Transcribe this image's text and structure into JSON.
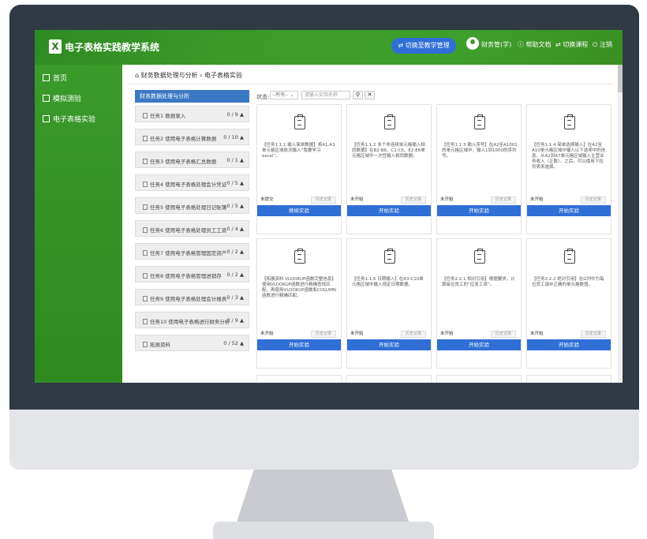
{
  "header": {
    "logo_letter": "X",
    "app_title": "电子表格实践教学系统",
    "switch_label": "切换至教学管理",
    "user_name": "财务管(学)",
    "help_label": "帮助文档",
    "course_switch_label": "切换课程",
    "logout_label": "注销"
  },
  "sidebar": {
    "items": [
      {
        "label": "首页",
        "icon": "home-icon"
      },
      {
        "label": "模拟测验",
        "icon": "quiz-icon"
      },
      {
        "label": "电子表格实验",
        "icon": "spreadsheet-icon"
      }
    ]
  },
  "breadcrumb": {
    "first": "财务数据处理与分析",
    "separator": "›",
    "second": "电子表格实验"
  },
  "tasks": {
    "header": "财务数据处理与分析",
    "items": [
      {
        "label": "任务1 数据录入",
        "count": "0 / 9"
      },
      {
        "label": "任务2 使用电子表格计算数据",
        "count": "0 / 10"
      },
      {
        "label": "任务3 使用电子表格汇总数据",
        "count": "0 / 1"
      },
      {
        "label": "任务4 使用电子表格处理会计凭证",
        "count": "0 / 5"
      },
      {
        "label": "任务5 使用电子表格处理日记账簿",
        "count": "0 / 5"
      },
      {
        "label": "任务6 使用电子表格处理员工工资",
        "count": "0 / 4"
      },
      {
        "label": "任务7 使用电子表格管理固定资产",
        "count": "0 / 2"
      },
      {
        "label": "任务8 使用电子表格管理进销存",
        "count": "0 / 2"
      },
      {
        "label": "任务9 使用电子表格处理会计报表",
        "count": "0 / 3"
      },
      {
        "label": "任务10 使用电子表格进行财务分析",
        "count": "0 / 9"
      },
      {
        "label": "拓展资料",
        "count": "0 / 52"
      }
    ]
  },
  "filter": {
    "label": "状态:",
    "select_value": "--所有--",
    "search_placeholder": "请输入实验名称",
    "search_icon": "search-icon",
    "clear_icon": "close-icon"
  },
  "cards": [
    {
      "desc": "【任务1.1.1 输入简单数据】将A1:A3单元格区域依次输入“我要学习excel”。",
      "status": "未提交",
      "history": "历史记录",
      "button": "继续实验"
    },
    {
      "desc": "【任务1.1.2 多个非连续单元格输入相同数据】在B2:B6、C2:C6、E2:E6单元格区域中一次性输入相同数据。",
      "status": "未开始",
      "history": "历史记录",
      "button": "开始实验"
    },
    {
      "desc": "【任务1.1.3 输入序号】在A2至A1001的单元格区域中，输入1到1000的序列号。",
      "status": "未开始",
      "history": "历史记录",
      "button": "开始实验"
    },
    {
      "desc": "【任务1.1.4 简单选择输入】在A2至A10单元格区域中输入以下选项中的信息，从A2到A7单元格区域输入主营业务收入（正数），之后，可以使用下拉列表来选择。",
      "status": "未开始",
      "history": "历史记录",
      "button": "开始实验"
    },
    {
      "desc": "【拓展资料 VLOOKUP函数完整信息】使用VLOOKUP函数进行精确查找匹配，再使用VLOOKUP函数和COLUMN函数进行精确匹配。",
      "status": "未开始",
      "history": "历史记录",
      "button": "开始实验"
    },
    {
      "desc": "【任务1.1.6 日期输入】在A3:C10单元格区域中输入规定日期数据。",
      "status": "未开始",
      "history": "历史记录",
      "button": "开始实验"
    },
    {
      "desc": "【任务2.2.1 相对引用】根据要求，计算每位员工的“应发工资”。",
      "status": "未开始",
      "history": "历史记录",
      "button": "开始实验"
    },
    {
      "desc": "【任务2.2.2 绝对引用】在G列中为每位员工填补正确的单元格数值。",
      "status": "未开始",
      "history": "历史记录",
      "button": "开始实验"
    }
  ],
  "colors": {
    "brand_green": "#3d9b2a",
    "accent_blue": "#2f6fd6",
    "task_header_blue": "#3b78c4"
  }
}
